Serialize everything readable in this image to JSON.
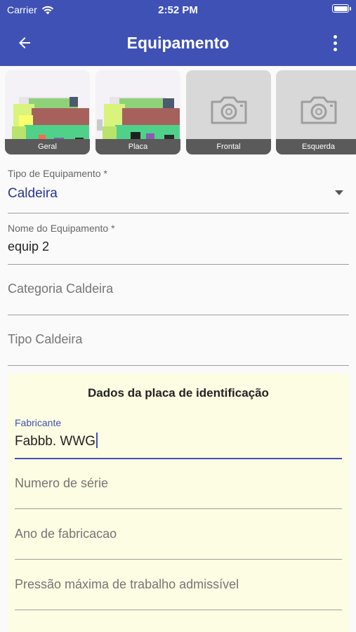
{
  "status_bar": {
    "carrier": "Carrier",
    "time": "2:52 PM"
  },
  "app_bar": {
    "title": "Equipamento",
    "back_icon": "arrow-back-icon",
    "menu_icon": "more-vert-icon"
  },
  "photos": [
    {
      "label": "Geral",
      "has_image": true
    },
    {
      "label": "Placa",
      "has_image": true
    },
    {
      "label": "Frontal",
      "has_image": false
    },
    {
      "label": "Esquerda",
      "has_image": false
    }
  ],
  "form": {
    "tipo_equipamento": {
      "label": "Tipo de Equipamento *",
      "value": "Caldeira"
    },
    "nome_equipamento": {
      "label": "Nome do Equipamento *",
      "value": "equip 2"
    },
    "categoria": {
      "placeholder": "Categoria Caldeira"
    },
    "tipo_caldeira": {
      "placeholder": "Tipo Caldeira"
    }
  },
  "plate_card": {
    "title": "Dados da placa de identificação",
    "fabricante": {
      "label": "Fabricante",
      "value": "Fabbb.  WWG"
    },
    "numero_serie": {
      "placeholder": "Numero de série"
    },
    "ano_fabricacao": {
      "placeholder": "Ano de fabricacao"
    },
    "pressao_maxima": {
      "placeholder": "Pressão máxima de trabalho admissível"
    }
  },
  "colors": {
    "primary": "#3f51b5",
    "card_background": "#fdfde3",
    "value_text": "#283593"
  }
}
